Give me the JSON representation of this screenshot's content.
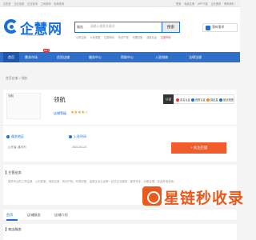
{
  "topbar": {
    "left": [
      "企查查",
      "企业信用",
      "企业查询",
      "工商查询",
      "信用查询"
    ],
    "right": [
      "登录",
      "免费注册",
      "APP下载",
      "企业服务",
      "联系我们"
    ]
  },
  "logo": {
    "text": "企慧网",
    "sub": "QIHUI.COM"
  },
  "search": {
    "scope": "服务",
    "placeholder": "请输入搜索关键词",
    "button": "搜索",
    "hotwords": [
      "公司注册",
      "公司变更",
      "注册商标",
      "知识产权",
      "代理记账",
      "高新认证",
      "网站建设"
    ],
    "hot_red": "注册商标"
  },
  "user_entry": "我有需求",
  "nav": {
    "items": [
      "首页",
      "需求市场",
      "优质店铺",
      "服务中心",
      "帮助中心",
      "入驻指南",
      "法律法规"
    ],
    "hot": "HOT"
  },
  "breadcrumb": "首页店铺 > 领航",
  "shop": {
    "image_alt": "领航",
    "name": "领航",
    "level_label": "店铺等级",
    "stars": "★★★★☆",
    "cert_label": "认证",
    "tags": [
      "实名认证",
      "资质认证",
      "保证金",
      "营业执照"
    ]
  },
  "info": {
    "area_label": "服务地区",
    "area_value": "山东省-潍坊市",
    "join_label": "入驻时间",
    "join_value": "2021-04-21"
  },
  "follow_button": "+ 关注店铺",
  "business": {
    "title": "主营业务",
    "text": "提供专业的工商注册、公司变更、商标注册、知识产权、代理记账、高新企业认证等一站式企业服务，服务专业，价格合理，欢迎来电咨询。"
  },
  "tabs": [
    "首页",
    "店铺服务",
    "店铺介绍"
  ],
  "news": {
    "title": "本店服务"
  },
  "watermark": "星链秒收录",
  "colors": {
    "brand": "#1a6fd9",
    "nav": "#2f6fc9",
    "accent": "#f25c2b",
    "watermark": "#e85a1e"
  }
}
